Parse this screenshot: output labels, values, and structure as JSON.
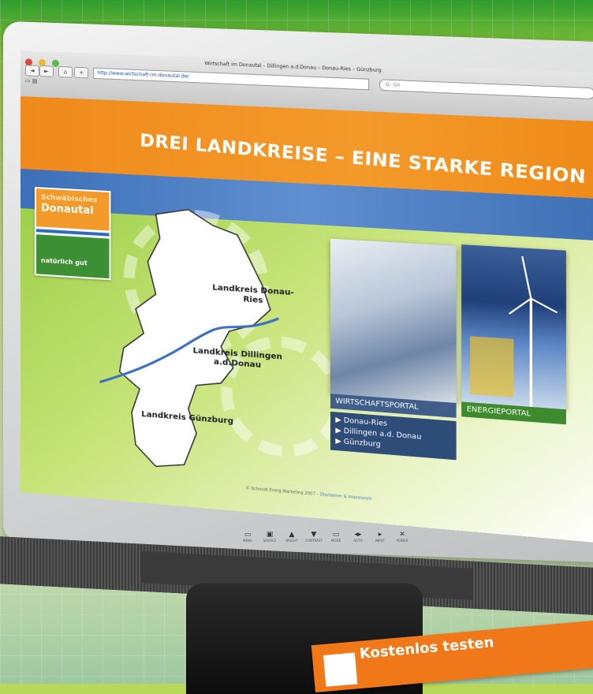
{
  "browser": {
    "window_title": "Wirtschaft im Donautal – Dillingen a.d.Donau – Donau-Ries – Günzburg",
    "url": "http://www.wirtschaft-im-donautal.de/",
    "search_placeholder": "Q- Go",
    "nav_back": "◄",
    "nav_forward": "►",
    "nav_home": "⌂",
    "nav_add": "+"
  },
  "page": {
    "headline": "DREI LANDKREISE – EINE STARKE REGION",
    "logo": {
      "line1": "Schwäbisches",
      "line2": "Donautal",
      "tagline": "natürlich gut"
    },
    "map_labels": [
      "Landkreis Donau-Ries",
      "Landkreis Dillingen a.d.Donau",
      "Landkreis Günzburg"
    ],
    "wirtschaftsportal": {
      "title": "WIRTSCHAFTSPORTAL",
      "links": [
        "▶ Donau-Ries",
        "▶ Dillingen a.d. Donau",
        "▶ Günzburg"
      ]
    },
    "energieportal": {
      "title": "ENERGIEPORTAL"
    },
    "footer_text": "© Schmidt Energ Marketing 2007 –",
    "footer_link": "Disclaimer & Impressum"
  },
  "monitor": {
    "controls": [
      "▭",
      "▣",
      "▲",
      "▼",
      "▭",
      "◂▸",
      "▸",
      "✕"
    ],
    "control_labels": [
      "MENU",
      "SOURCE",
      "BRIGHT",
      "CONTRAST",
      "MODE",
      "AUTO",
      "INPUT",
      "POWER"
    ]
  },
  "banner": {
    "text": "Kostenlos testen"
  },
  "colors": {
    "orange": "#f08a1c",
    "blue_band": "#3c6fb8",
    "green": "#3e8a2e",
    "portal_blue": "#2e4c78"
  }
}
